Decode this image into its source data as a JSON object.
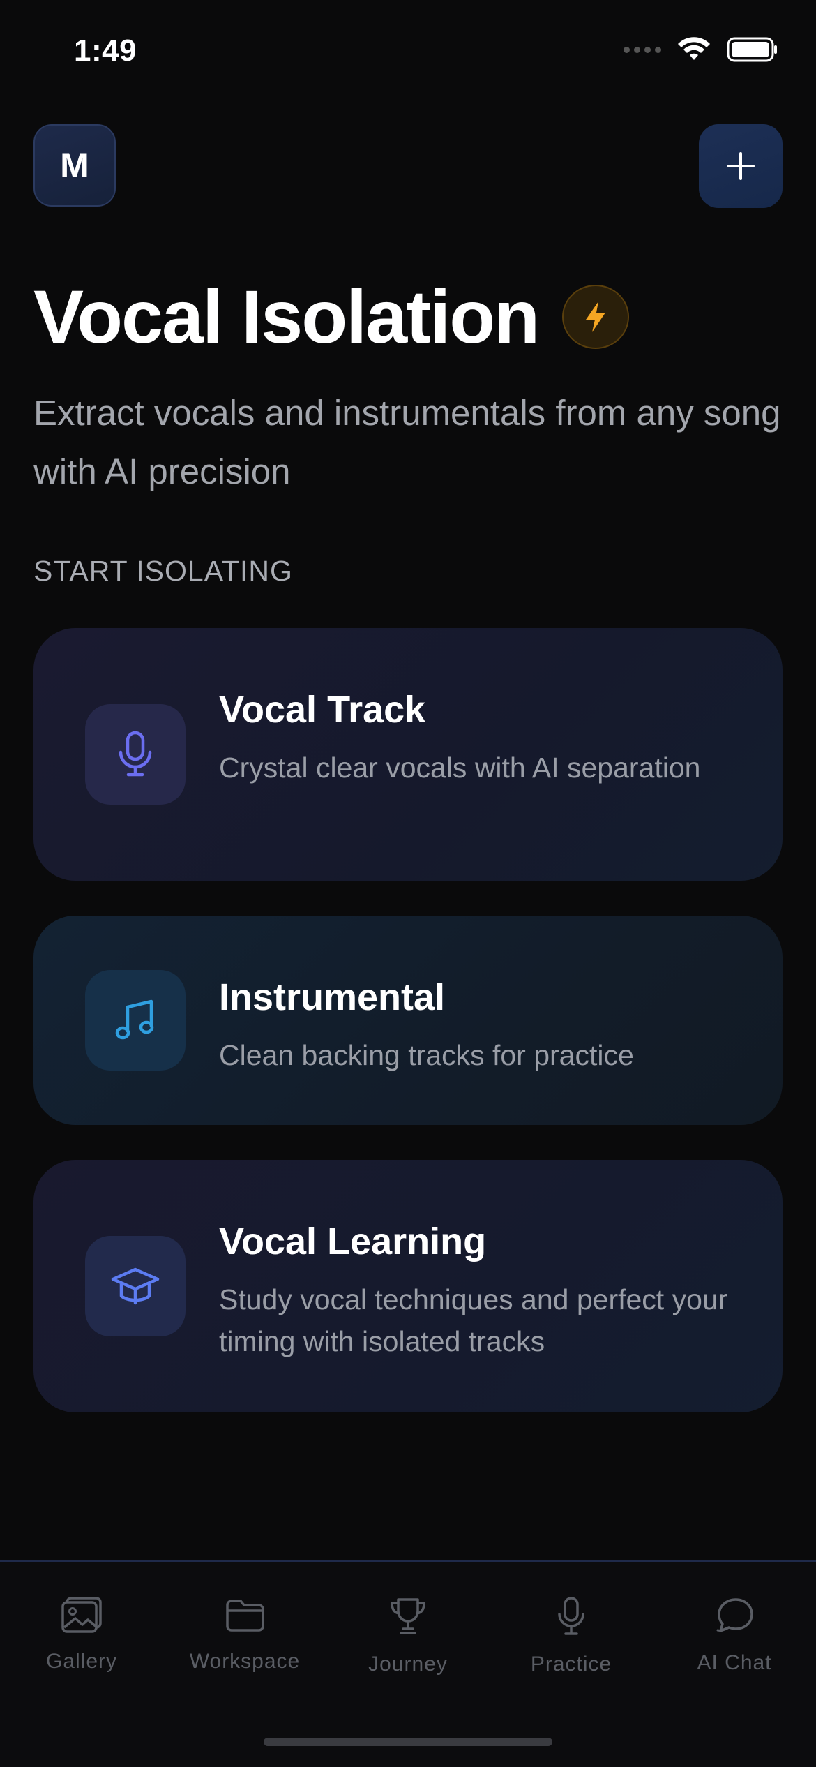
{
  "status_bar": {
    "time": "1:49"
  },
  "header": {
    "avatar_initial": "M"
  },
  "page": {
    "title": "Vocal Isolation",
    "subtitle": "Extract vocals and instrumentals from any song with AI precision",
    "section_label": "START ISOLATING"
  },
  "cards": [
    {
      "title": "Vocal Track",
      "description": "Crystal clear vocals with AI separation",
      "icon": "microphone-icon"
    },
    {
      "title": "Instrumental",
      "description": "Clean backing tracks for practice",
      "icon": "music-note-icon"
    },
    {
      "title": "Vocal Learning",
      "description": "Study vocal techniques and perfect your timing with isolated tracks",
      "icon": "graduation-cap-icon"
    }
  ],
  "tabs": [
    {
      "label": "Gallery",
      "icon": "gallery-icon"
    },
    {
      "label": "Workspace",
      "icon": "folder-icon"
    },
    {
      "label": "Journey",
      "icon": "trophy-icon"
    },
    {
      "label": "Practice",
      "icon": "microphone-icon"
    },
    {
      "label": "AI Chat",
      "icon": "chat-bubble-icon"
    }
  ],
  "colors": {
    "background": "#0a0a0b",
    "accent_indigo": "#6b6ef0",
    "accent_cyan": "#2f9fe0",
    "bolt_amber": "#f5a623",
    "tab_inactive": "#5a5d64"
  }
}
